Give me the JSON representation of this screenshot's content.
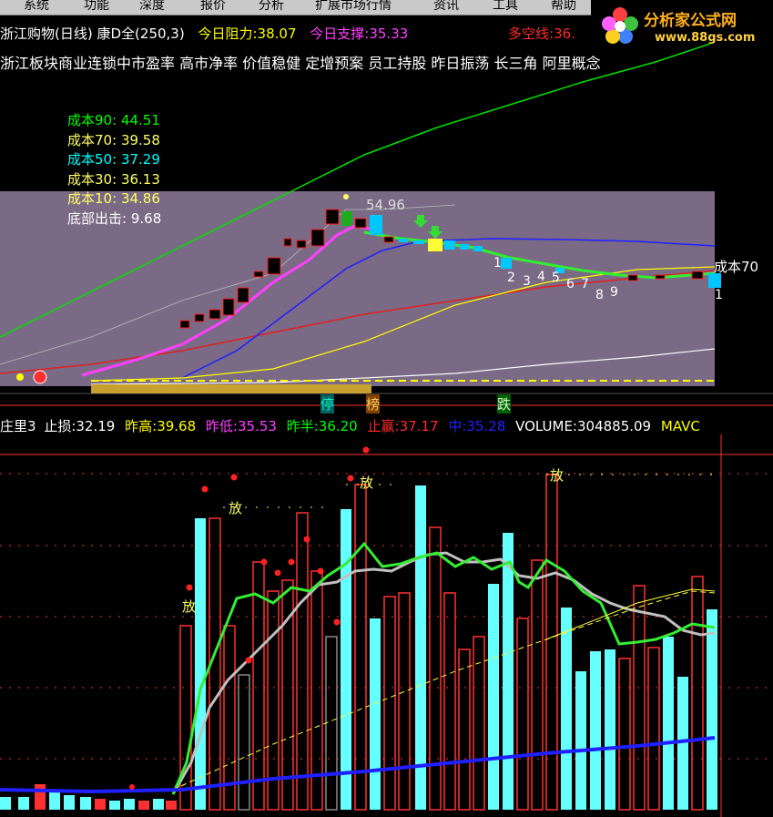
{
  "menu": [
    "系统",
    "功能",
    "深度",
    "报价",
    "分析",
    "扩展市场行情",
    "资讯",
    "工具",
    "帮助"
  ],
  "logo": {
    "name": "分析家公式网",
    "url": "www.88gs.com"
  },
  "header": {
    "title": "浙江购物(日线)",
    "indicator": "康D全(250,3)",
    "resist_label": "今日阻力:",
    "resist_value": "38.07",
    "support_label": "今日支撑:",
    "support_value": "35.33",
    "longshort_label": "多空线:",
    "longshort_value": "36."
  },
  "concepts": "浙江板块商业连锁中市盈率 高市净率 价值稳健 定增预案 员工持股 昨日振荡 长三角 阿里概念",
  "cost_list": [
    {
      "label": "成本90:",
      "value": "44.51",
      "color": "#00ff00"
    },
    {
      "label": "成本70:",
      "value": "39.58",
      "color": "#ffff66"
    },
    {
      "label": "成本50:",
      "value": "37.29",
      "color": "#00ffff"
    },
    {
      "label": "成本30:",
      "value": "36.13",
      "color": "#ffff66"
    },
    {
      "label": "成本10:",
      "value": "34.86",
      "color": "#ffff66"
    },
    {
      "label": "底部出击:",
      "value": "9.68",
      "color": "#ffffff"
    }
  ],
  "price_labels": {
    "high": "54.96",
    "cost70": "成本70"
  },
  "wave_numbers": [
    "1",
    "2",
    "3",
    "4",
    "5",
    "6",
    "7",
    "8",
    "9",
    "1"
  ],
  "signals": {
    "ting": "停",
    "bang": "榜",
    "die": "跌",
    "fang": "放"
  },
  "lower_header": {
    "name": "庄里3",
    "stop_label": "止损:",
    "stop_value": "32.19",
    "high_label": "昨高:",
    "high_value": "39.68",
    "low_label": "昨低:",
    "low_value": "35.53",
    "half_label": "昨半:",
    "half_value": "36.20",
    "profit_label": "止赢:",
    "profit_value": "37.17",
    "mid_label": "中:",
    "mid_value": "35.28",
    "volume_label": "VOLUME:",
    "volume_value": "304885.09",
    "mavc": "MAVC"
  },
  "colors": {
    "bg": "#000000",
    "green": "#00ff00",
    "red": "#ff2a2a",
    "magenta": "#ff40ff",
    "blue": "#2020ff",
    "yellow": "#ffff00",
    "cyan": "#00ffff"
  }
}
